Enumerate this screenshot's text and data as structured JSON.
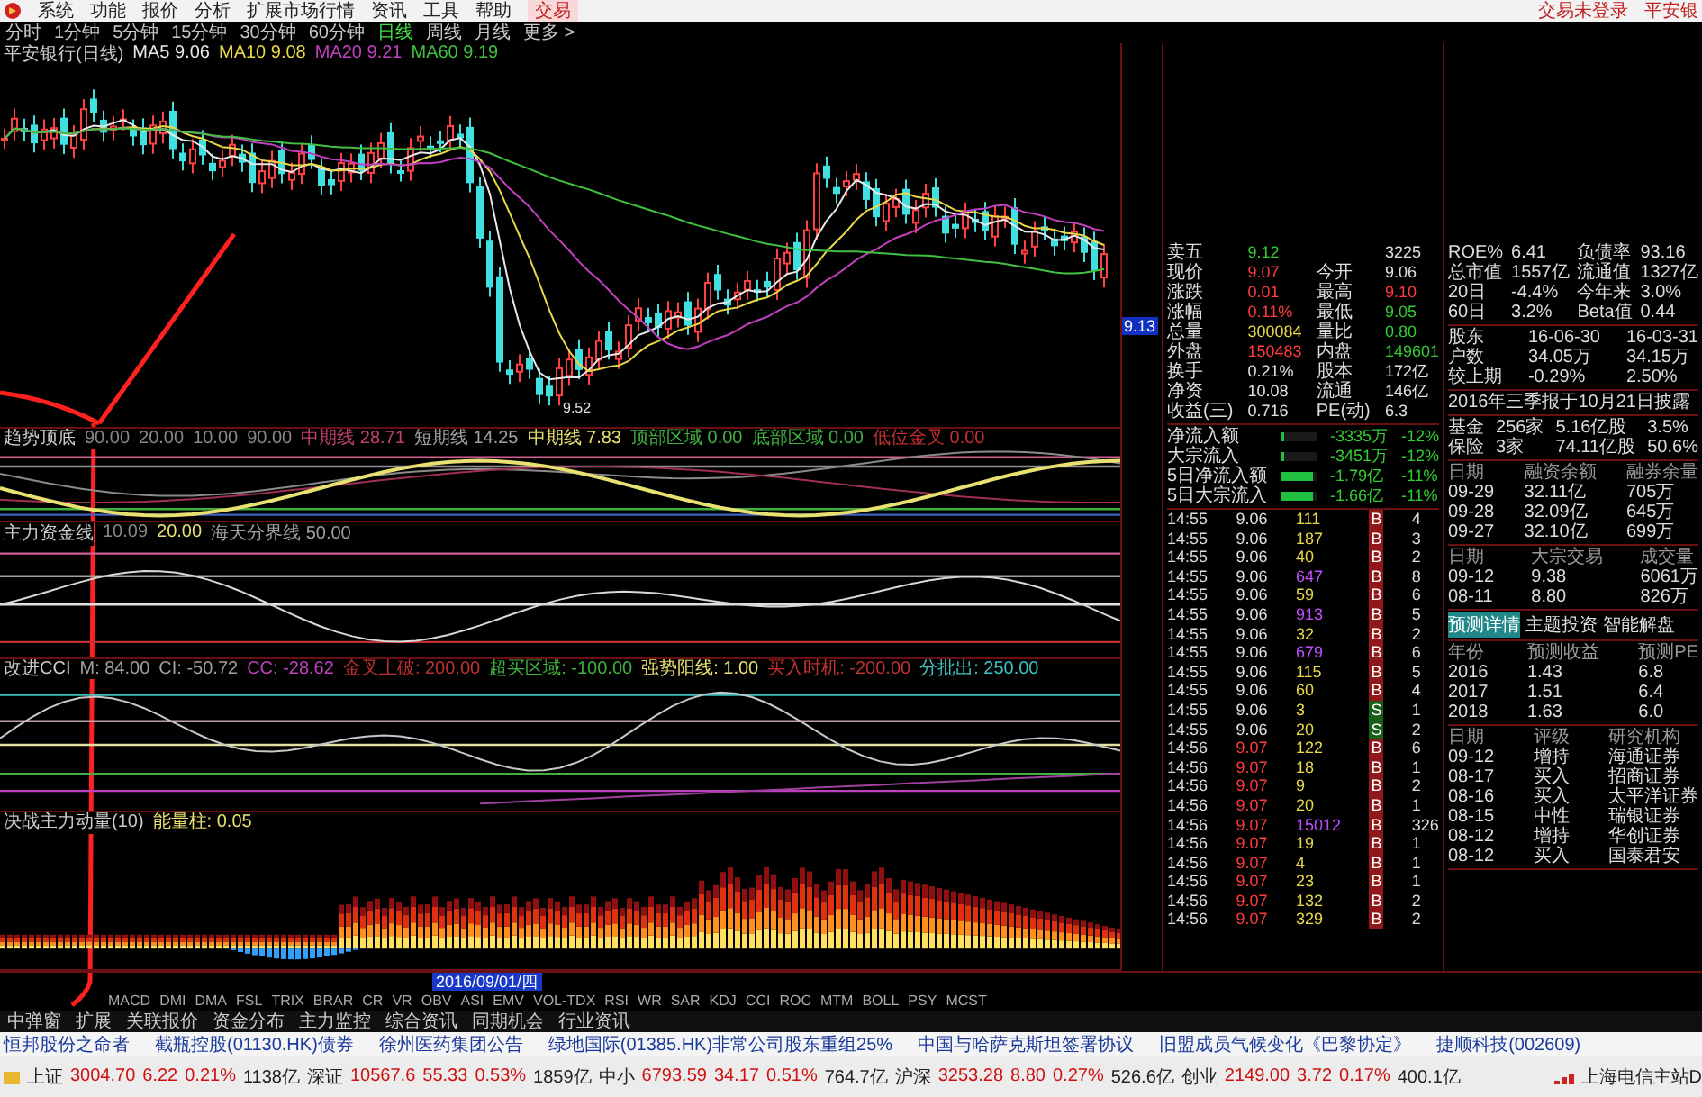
{
  "menu": {
    "items": [
      {
        "label": "系统",
        "kind": "menu"
      },
      {
        "label": "功能",
        "kind": "menu"
      },
      {
        "label": "报价",
        "kind": "menu"
      },
      {
        "label": "分析",
        "kind": "menu"
      },
      {
        "label": "扩展市场行情",
        "kind": "menu"
      },
      {
        "label": "资讯",
        "kind": "menu"
      },
      {
        "label": "工具",
        "kind": "menu"
      },
      {
        "label": "帮助",
        "kind": "menu"
      },
      {
        "label": "交易",
        "kind": "trade"
      }
    ],
    "login_status": "交易未登录",
    "stock_name": "平安银"
  },
  "periods": [
    {
      "label": "分时",
      "selected": false
    },
    {
      "label": "1分钟",
      "selected": false
    },
    {
      "label": "5分钟",
      "selected": false
    },
    {
      "label": "15分钟",
      "selected": false
    },
    {
      "label": "30分钟",
      "selected": false
    },
    {
      "label": "60分钟",
      "selected": false
    },
    {
      "label": "日线",
      "selected": true
    },
    {
      "label": "周线",
      "selected": false
    },
    {
      "label": "月线",
      "selected": false
    },
    {
      "label": "更多 >",
      "selected": false
    }
  ],
  "price_chart": {
    "title": "平安银行(日线)",
    "ma": [
      {
        "label": "MA5",
        "value": "9.06",
        "color": "#e8e8e8"
      },
      {
        "label": "MA10",
        "value": "9.08",
        "color": "#e8d848"
      },
      {
        "label": "MA20",
        "value": "9.21",
        "color": "#c040c0"
      },
      {
        "label": "MA60",
        "value": "9.19",
        "color": "#40c040"
      }
    ],
    "low_mark": "9.52",
    "price_tag": "9.13"
  },
  "indicators": [
    {
      "kind": "trend",
      "title": "趋势顶底",
      "params": [
        {
          "value": "90.00",
          "color": "#888888"
        },
        {
          "value": "20.00",
          "color": "#888888"
        },
        {
          "value": "10.00",
          "color": "#888888"
        },
        {
          "value": "90.00",
          "color": "#888888"
        },
        {
          "label": "中期线",
          "value": "28.71",
          "color": "#c04070"
        },
        {
          "label": "短期线",
          "value": "14.25",
          "color": "#a0a0a0"
        },
        {
          "label": "中期线",
          "value": "7.83",
          "color": "#e8e070"
        },
        {
          "label": "顶部区域",
          "value": "0.00",
          "color": "#40b040"
        },
        {
          "label": "底部区域",
          "value": "0.00",
          "color": "#40b040"
        },
        {
          "label": "低位金叉",
          "value": "0.00",
          "color": "#c03030"
        }
      ]
    },
    {
      "kind": "capital",
      "title": "主力资金线",
      "params": [
        {
          "value": "10.09",
          "color": "#888888"
        },
        {
          "value": "20.00",
          "color": "#e8e070"
        },
        {
          "label": "海天分界线",
          "value": "50.00",
          "color": "#a0a0a0"
        }
      ]
    },
    {
      "kind": "cci",
      "title": "改进CCI",
      "params": [
        {
          "label": "M:",
          "value": "84.00",
          "color": "#a0a0a0"
        },
        {
          "label": "CI:",
          "value": "-50.72",
          "color": "#a0a0a0"
        },
        {
          "label": "CC:",
          "value": "-28.62",
          "color": "#c040c0"
        },
        {
          "label": "金叉上破:",
          "value": "200.00",
          "color": "#c03030"
        },
        {
          "label": "超买区域:",
          "value": "-100.00",
          "color": "#40b040"
        },
        {
          "label": "强势阳线:",
          "value": "1.00",
          "color": "#e8e070"
        },
        {
          "label": "买入时机:",
          "value": "-200.00",
          "color": "#c03030"
        },
        {
          "label": "分批出:",
          "value": "250.00",
          "color": "#40c0c0"
        }
      ]
    },
    {
      "kind": "energy",
      "title": "决战主力动量(10)",
      "params": [
        {
          "label": "能量柱:",
          "value": "0.05",
          "color": "#e8e070"
        }
      ]
    }
  ],
  "date_axis": {
    "highlight": "2016/09/01/四"
  },
  "indicator_tabs": [
    "MACD",
    "DMI",
    "DMA",
    "FSL",
    "TRIX",
    "BRAR",
    "CR",
    "VR",
    "OBV",
    "ASI",
    "EMV",
    "VOL-TDX",
    "RSI",
    "WR",
    "SAR",
    "KDJ",
    "CCI",
    "ROC",
    "MTM",
    "BOLL",
    "PSY",
    "MCST"
  ],
  "bottom_tabs": [
    "中弹窗",
    "扩展",
    "关联报价",
    "资金分布",
    "主力监控",
    "综合资讯",
    "同期机会",
    "行业资讯"
  ],
  "quote": [
    {
      "label": "卖五",
      "value": "9.12",
      "color": "#33cc33"
    },
    {
      "value": "3225",
      "color": "#e0e0e0"
    },
    {
      "label": "现价",
      "value": "9.07",
      "color": "#ff3b3b"
    },
    {
      "label": "今开",
      "value": "9.06",
      "color": "#e0e0e0"
    },
    {
      "label": "涨跌",
      "value": "0.01",
      "color": "#ff3b3b"
    },
    {
      "label": "最高",
      "value": "9.10",
      "color": "#ff3b3b"
    },
    {
      "label": "涨幅",
      "value": "0.11%",
      "color": "#ff3b3b"
    },
    {
      "label": "最低",
      "value": "9.05",
      "color": "#33cc33"
    },
    {
      "label": "总量",
      "value": "300084",
      "color": "#e8d848"
    },
    {
      "label": "量比",
      "value": "0.80",
      "color": "#33cc33"
    },
    {
      "label": "外盘",
      "value": "150483",
      "color": "#ff3b3b"
    },
    {
      "label": "内盘",
      "value": "149601",
      "color": "#33cc33"
    },
    {
      "label": "换手",
      "value": "0.21%",
      "color": "#e0e0e0"
    },
    {
      "label": "股本",
      "value": "172亿",
      "color": "#e0e0e0"
    },
    {
      "label": "净资",
      "value": "10.08",
      "color": "#e0e0e0"
    },
    {
      "label": "流通",
      "value": "146亿",
      "color": "#e0e0e0"
    },
    {
      "label": "收益(三)",
      "value": "0.716",
      "color": "#e0e0e0"
    },
    {
      "label": "PE(动)",
      "value": "6.3",
      "color": "#e0e0e0"
    }
  ],
  "fund_flow": [
    {
      "label": "净流入额",
      "level": 0.1,
      "value": "-3335万",
      "pct": "-12%"
    },
    {
      "label": "大宗流入",
      "level": 0.1,
      "value": "-3451万",
      "pct": "-12%"
    },
    {
      "label": "5日净流入额",
      "level": 0.9,
      "value": "-1.79亿",
      "pct": "-11%"
    },
    {
      "label": "5日大宗流入",
      "level": 0.9,
      "value": "-1.66亿",
      "pct": "-11%"
    }
  ],
  "ticks": [
    {
      "time": "14:55",
      "price": "9.06",
      "color": "#e0e0e0",
      "volume": "111",
      "big": false,
      "flag": "B",
      "kind": "buy",
      "count": "4"
    },
    {
      "time": "14:55",
      "price": "9.06",
      "color": "#e0e0e0",
      "volume": "187",
      "big": false,
      "flag": "B",
      "kind": "buy",
      "count": "3"
    },
    {
      "time": "14:55",
      "price": "9.06",
      "color": "#e0e0e0",
      "volume": "40",
      "big": false,
      "flag": "B",
      "kind": "buy",
      "count": "2"
    },
    {
      "time": "14:55",
      "price": "9.06",
      "color": "#e0e0e0",
      "volume": "647",
      "big": true,
      "flag": "B",
      "kind": "buy",
      "count": "8"
    },
    {
      "time": "14:55",
      "price": "9.06",
      "color": "#e0e0e0",
      "volume": "59",
      "big": false,
      "flag": "B",
      "kind": "buy",
      "count": "6"
    },
    {
      "time": "14:55",
      "price": "9.06",
      "color": "#e0e0e0",
      "volume": "913",
      "big": true,
      "flag": "B",
      "kind": "buy",
      "count": "5"
    },
    {
      "time": "14:55",
      "price": "9.06",
      "color": "#e0e0e0",
      "volume": "32",
      "big": false,
      "flag": "B",
      "kind": "buy",
      "count": "2"
    },
    {
      "time": "14:55",
      "price": "9.06",
      "color": "#e0e0e0",
      "volume": "679",
      "big": true,
      "flag": "B",
      "kind": "buy",
      "count": "6"
    },
    {
      "time": "14:55",
      "price": "9.06",
      "color": "#e0e0e0",
      "volume": "115",
      "big": false,
      "flag": "B",
      "kind": "buy",
      "count": "5"
    },
    {
      "time": "14:55",
      "price": "9.06",
      "color": "#e0e0e0",
      "volume": "60",
      "big": false,
      "flag": "B",
      "kind": "buy",
      "count": "4"
    },
    {
      "time": "14:55",
      "price": "9.06",
      "color": "#e0e0e0",
      "volume": "3",
      "big": false,
      "flag": "S",
      "kind": "sell",
      "count": "1"
    },
    {
      "time": "14:55",
      "price": "9.06",
      "color": "#e0e0e0",
      "volume": "20",
      "big": false,
      "flag": "S",
      "kind": "sell",
      "count": "2"
    },
    {
      "time": "14:56",
      "price": "9.07",
      "color": "#ff3b3b",
      "volume": "122",
      "big": false,
      "flag": "B",
      "kind": "buy",
      "count": "6"
    },
    {
      "time": "14:56",
      "price": "9.07",
      "color": "#ff3b3b",
      "volume": "18",
      "big": false,
      "flag": "B",
      "kind": "buy",
      "count": "1"
    },
    {
      "time": "14:56",
      "price": "9.07",
      "color": "#ff3b3b",
      "volume": "9",
      "big": false,
      "flag": "B",
      "kind": "buy",
      "count": "2"
    },
    {
      "time": "14:56",
      "price": "9.07",
      "color": "#ff3b3b",
      "volume": "20",
      "big": false,
      "flag": "B",
      "kind": "buy",
      "count": "1"
    },
    {
      "time": "14:56",
      "price": "9.07",
      "color": "#ff3b3b",
      "volume": "15012",
      "big": true,
      "flag": "B",
      "kind": "buy",
      "count": "326"
    },
    {
      "time": "14:56",
      "price": "9.07",
      "color": "#ff3b3b",
      "volume": "19",
      "big": false,
      "flag": "B",
      "kind": "buy",
      "count": "1"
    },
    {
      "time": "14:56",
      "price": "9.07",
      "color": "#ff3b3b",
      "volume": "4",
      "big": false,
      "flag": "B",
      "kind": "buy",
      "count": "1"
    },
    {
      "time": "14:56",
      "price": "9.07",
      "color": "#ff3b3b",
      "volume": "23",
      "big": false,
      "flag": "B",
      "kind": "buy",
      "count": "1"
    },
    {
      "time": "14:56",
      "price": "9.07",
      "color": "#ff3b3b",
      "volume": "132",
      "big": false,
      "flag": "B",
      "kind": "buy",
      "count": "2"
    },
    {
      "time": "14:56",
      "price": "9.07",
      "color": "#ff3b3b",
      "volume": "329",
      "big": false,
      "flag": "B",
      "kind": "buy",
      "count": "2"
    }
  ],
  "f10": [
    {
      "kind": "grid",
      "rows": [
        [
          "ROE%",
          "6.41",
          "负债率",
          "93.16"
        ],
        [
          "总市值",
          "1557亿",
          "流通值",
          "1327亿"
        ],
        [
          "20日",
          "-4.4%",
          "今年来",
          "3.0%"
        ],
        [
          "60日",
          "3.2%",
          "Beta值",
          "0.44"
        ]
      ]
    },
    {
      "kind": "grid",
      "rows": [
        [
          "股东",
          "16-06-30",
          "16-03-31"
        ],
        [
          "户数",
          "34.05万",
          "34.15万"
        ],
        [
          "较上期",
          "-0.29%",
          "2.50%"
        ]
      ]
    },
    {
      "kind": "note",
      "text": "2016年三季报于10月21日披露"
    },
    {
      "kind": "grid",
      "rows": [
        [
          "基金",
          "256家",
          "5.16亿股",
          "3.5%"
        ],
        [
          "保险",
          "3家",
          "74.11亿股",
          "50.6%"
        ]
      ]
    },
    {
      "kind": "grid",
      "header": [
        "日期",
        "融资余额",
        "融券余量"
      ],
      "rows": [
        [
          "09-29",
          "32.11亿",
          "705万"
        ],
        [
          "09-28",
          "32.09亿",
          "645万"
        ],
        [
          "09-27",
          "32.10亿",
          "699万"
        ]
      ]
    },
    {
      "kind": "grid",
      "header": [
        "日期",
        "大宗交易",
        "成交量"
      ],
      "rows": [
        [
          "09-12",
          "9.38",
          "6061万"
        ],
        [
          "08-11",
          "8.80",
          "826万"
        ]
      ]
    },
    {
      "kind": "tabs",
      "items": [
        {
          "label": "预测详情",
          "selected": true
        },
        {
          "label": "主题投资",
          "selected": false
        },
        {
          "label": "智能解盘",
          "selected": false
        }
      ]
    },
    {
      "kind": "grid",
      "header": [
        "年份",
        "预测收益",
        "预测PE"
      ],
      "rows": [
        [
          "2016",
          "1.43",
          "6.8"
        ],
        [
          "2017",
          "1.51",
          "6.4"
        ],
        [
          "2018",
          "1.63",
          "6.0"
        ]
      ]
    },
    {
      "kind": "grid",
      "header": [
        "日期",
        "评级",
        "研究机构"
      ],
      "rows": [
        [
          "09-12",
          "增持",
          "海通证券"
        ],
        [
          "08-17",
          "买入",
          "招商证券"
        ],
        [
          "08-16",
          "买入",
          "太平洋证券"
        ],
        [
          "08-15",
          "中性",
          "瑞银证券"
        ],
        [
          "08-12",
          "增持",
          "华创证券"
        ],
        [
          "08-12",
          "买入",
          "国泰君安"
        ]
      ]
    }
  ],
  "news": [
    "恒邦股份之命者",
    "截瓶控股(01130.HK)债券",
    "徐州医药集团公告",
    "绿地国际(01385.HK)非常公司股东重组25%",
    "中国与哈萨克斯坦签署协议",
    "旧盟成员气候变化《巴黎协定》",
    "捷顺科技(002609)"
  ],
  "indices": [
    {
      "name": "上证",
      "price": "3004.70",
      "change": "6.22",
      "pct": "0.21%",
      "amount": "1138亿"
    },
    {
      "name": "深证",
      "price": "10567.6",
      "change": "55.33",
      "pct": "0.53%",
      "amount": "1859亿"
    },
    {
      "name": "中小",
      "price": "6793.59",
      "change": "34.17",
      "pct": "0.51%",
      "amount": "764.7亿"
    },
    {
      "name": "沪深",
      "price": "3253.28",
      "change": "8.80",
      "pct": "0.27%",
      "amount": "526.6亿"
    },
    {
      "name": "创业",
      "price": "2149.00",
      "change": "3.72",
      "pct": "0.17%",
      "amount": "400.1亿"
    }
  ],
  "server": "上海电信主站D"
}
